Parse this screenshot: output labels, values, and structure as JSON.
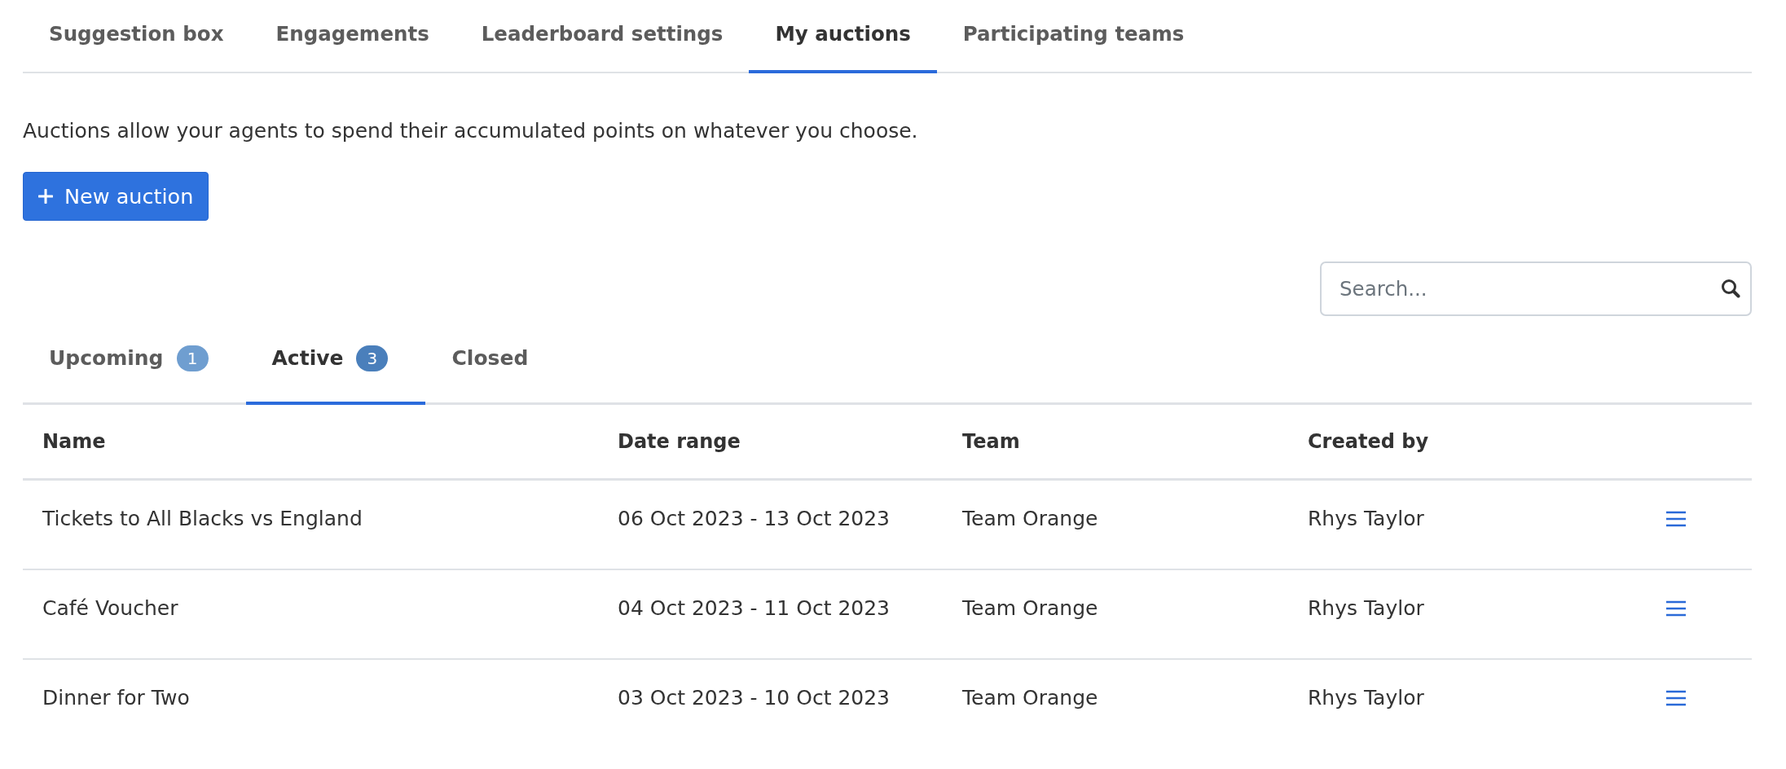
{
  "tabs": [
    {
      "label": "Suggestion box",
      "selected": false
    },
    {
      "label": "Engagements",
      "selected": false
    },
    {
      "label": "Leaderboard settings",
      "selected": false
    },
    {
      "label": "My auctions",
      "selected": true
    },
    {
      "label": "Participating teams",
      "selected": false
    }
  ],
  "intro": "Auctions allow your agents to spend their accumulated points on whatever you choose.",
  "new_button": {
    "label": "New auction"
  },
  "search": {
    "placeholder": "Search..."
  },
  "status_tabs": [
    {
      "label": "Upcoming",
      "count": "1",
      "selected": false
    },
    {
      "label": "Active",
      "count": "3",
      "selected": true
    },
    {
      "label": "Closed",
      "selected": false
    }
  ],
  "table": {
    "columns": [
      "Name",
      "Date range",
      "Team",
      "Created by"
    ],
    "rows": [
      {
        "name": "Tickets to All Blacks vs England",
        "date_range": "06 Oct 2023 - 13 Oct 2023",
        "team": "Team Orange",
        "created_by": "Rhys Taylor"
      },
      {
        "name": "Café Voucher",
        "date_range": "04 Oct 2023 - 11 Oct 2023",
        "team": "Team Orange",
        "created_by": "Rhys Taylor"
      },
      {
        "name": "Dinner for Two",
        "date_range": "03 Oct 2023 - 10 Oct 2023",
        "team": "Team Orange",
        "created_by": "Rhys Taylor"
      }
    ]
  }
}
